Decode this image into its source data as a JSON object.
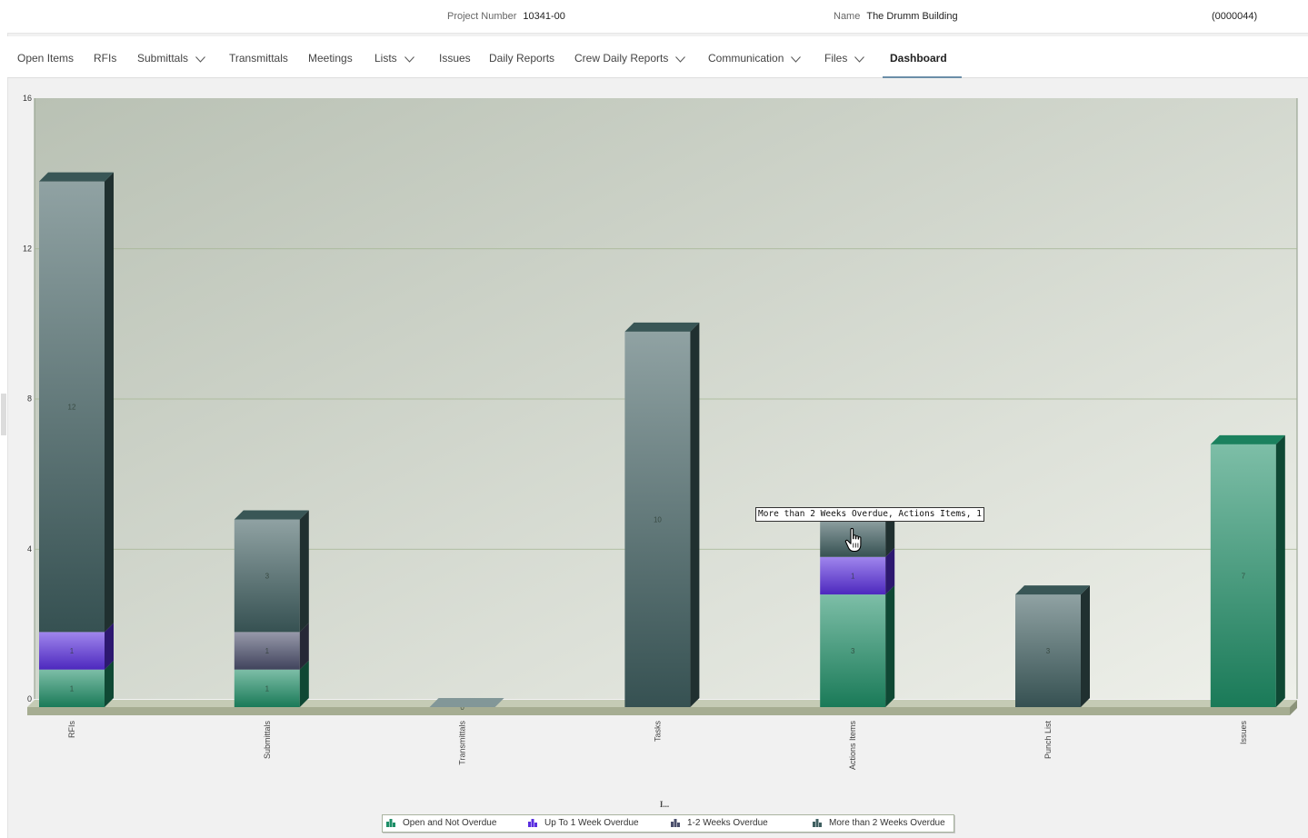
{
  "header": {
    "project_number_label": "Project Number",
    "project_number": "10341-00",
    "name_label": "Name",
    "name": "The Drumm Building",
    "code": "(0000044)"
  },
  "nav": {
    "tabs": [
      {
        "label": "Open Items",
        "dropdown": false,
        "active": false
      },
      {
        "label": "RFIs",
        "dropdown": false,
        "active": false
      },
      {
        "label": "Submittals",
        "dropdown": true,
        "active": false
      },
      {
        "label": "Transmittals",
        "dropdown": false,
        "active": false
      },
      {
        "label": "Meetings",
        "dropdown": false,
        "active": false
      },
      {
        "label": "Lists",
        "dropdown": true,
        "active": false
      },
      {
        "label": "Issues",
        "dropdown": false,
        "active": false
      },
      {
        "label": "Daily Reports",
        "dropdown": false,
        "active": false
      },
      {
        "label": "Crew Daily Reports",
        "dropdown": true,
        "active": false
      },
      {
        "label": "Communication",
        "dropdown": true,
        "active": false
      },
      {
        "label": "Files",
        "dropdown": true,
        "active": false
      },
      {
        "label": "Dashboard",
        "dropdown": false,
        "active": true
      }
    ]
  },
  "tooltip": "More than 2 Weeks Overdue,  Actions Items, 1",
  "colors": {
    "open": "#1e8f68",
    "up_to_1_week": "#5a2fe0",
    "one_to_two_weeks": "#4b4f6c",
    "more_than_2_weeks": "#3f5f60",
    "grid": "#a4b592",
    "plot_bg_top": "#b9c1b4",
    "plot_bg_bottom": "#eef0ea"
  },
  "chart_data": {
    "type": "bar",
    "stacked": true,
    "style": "3d",
    "categories": [
      "RFIs",
      "Submittals",
      "Transmittals",
      "Tasks",
      "Actions Items",
      "Punch List",
      "Issues"
    ],
    "series": [
      {
        "name": "Open and Not Overdue",
        "color_key": "open",
        "values": [
          1,
          1,
          0,
          0,
          3,
          0,
          7
        ]
      },
      {
        "name": "Up To 1 Week Overdue",
        "color_key": "up_to_1_week",
        "values": [
          1,
          0,
          0,
          0,
          1,
          0,
          0
        ]
      },
      {
        "name": "1-2 Weeks Overdue",
        "color_key": "one_to_two_weeks",
        "values": [
          0,
          1,
          0,
          0,
          0,
          0,
          0
        ]
      },
      {
        "name": "More than 2 Weeks Overdue",
        "color_key": "more_than_2_weeks",
        "values": [
          12,
          3,
          0,
          10,
          1,
          3,
          0
        ]
      }
    ],
    "ylim": [
      0,
      16
    ],
    "yticks": [
      0,
      4,
      8,
      12,
      16
    ],
    "xlabel": "I...",
    "ylabel": "",
    "grid": true,
    "legend_position": "bottom-center"
  }
}
